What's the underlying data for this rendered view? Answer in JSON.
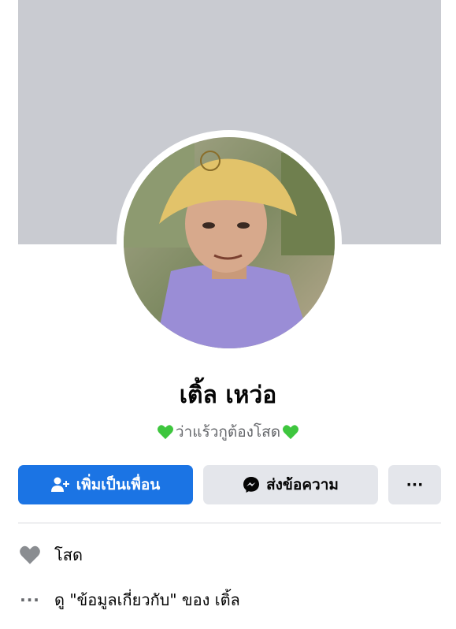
{
  "profile": {
    "name": "เติ้ล เหว่อ",
    "bio": "ว่าแร้วกูต้องโสด"
  },
  "actions": {
    "add_friend_label": "เพิ่มเป็นเพื่อน",
    "message_label": "ส่งข้อความ",
    "more_label": "···"
  },
  "intro": {
    "relationship": "โสด",
    "about_link": "ดู \"ข้อมูลเกี่ยวกับ\" ของ เติ้ล",
    "more_dots": "···"
  },
  "colors": {
    "primary": "#1b74e4",
    "secondary_button": "#e4e6eb",
    "cover": "#c9cbd1",
    "heart_green": "#3ec63e"
  },
  "icons": {
    "add_friend": "person-plus-icon",
    "message": "messenger-icon",
    "relationship": "heart-icon",
    "about": "more-dots-icon",
    "bio_decoration": "green-heart-icon"
  }
}
